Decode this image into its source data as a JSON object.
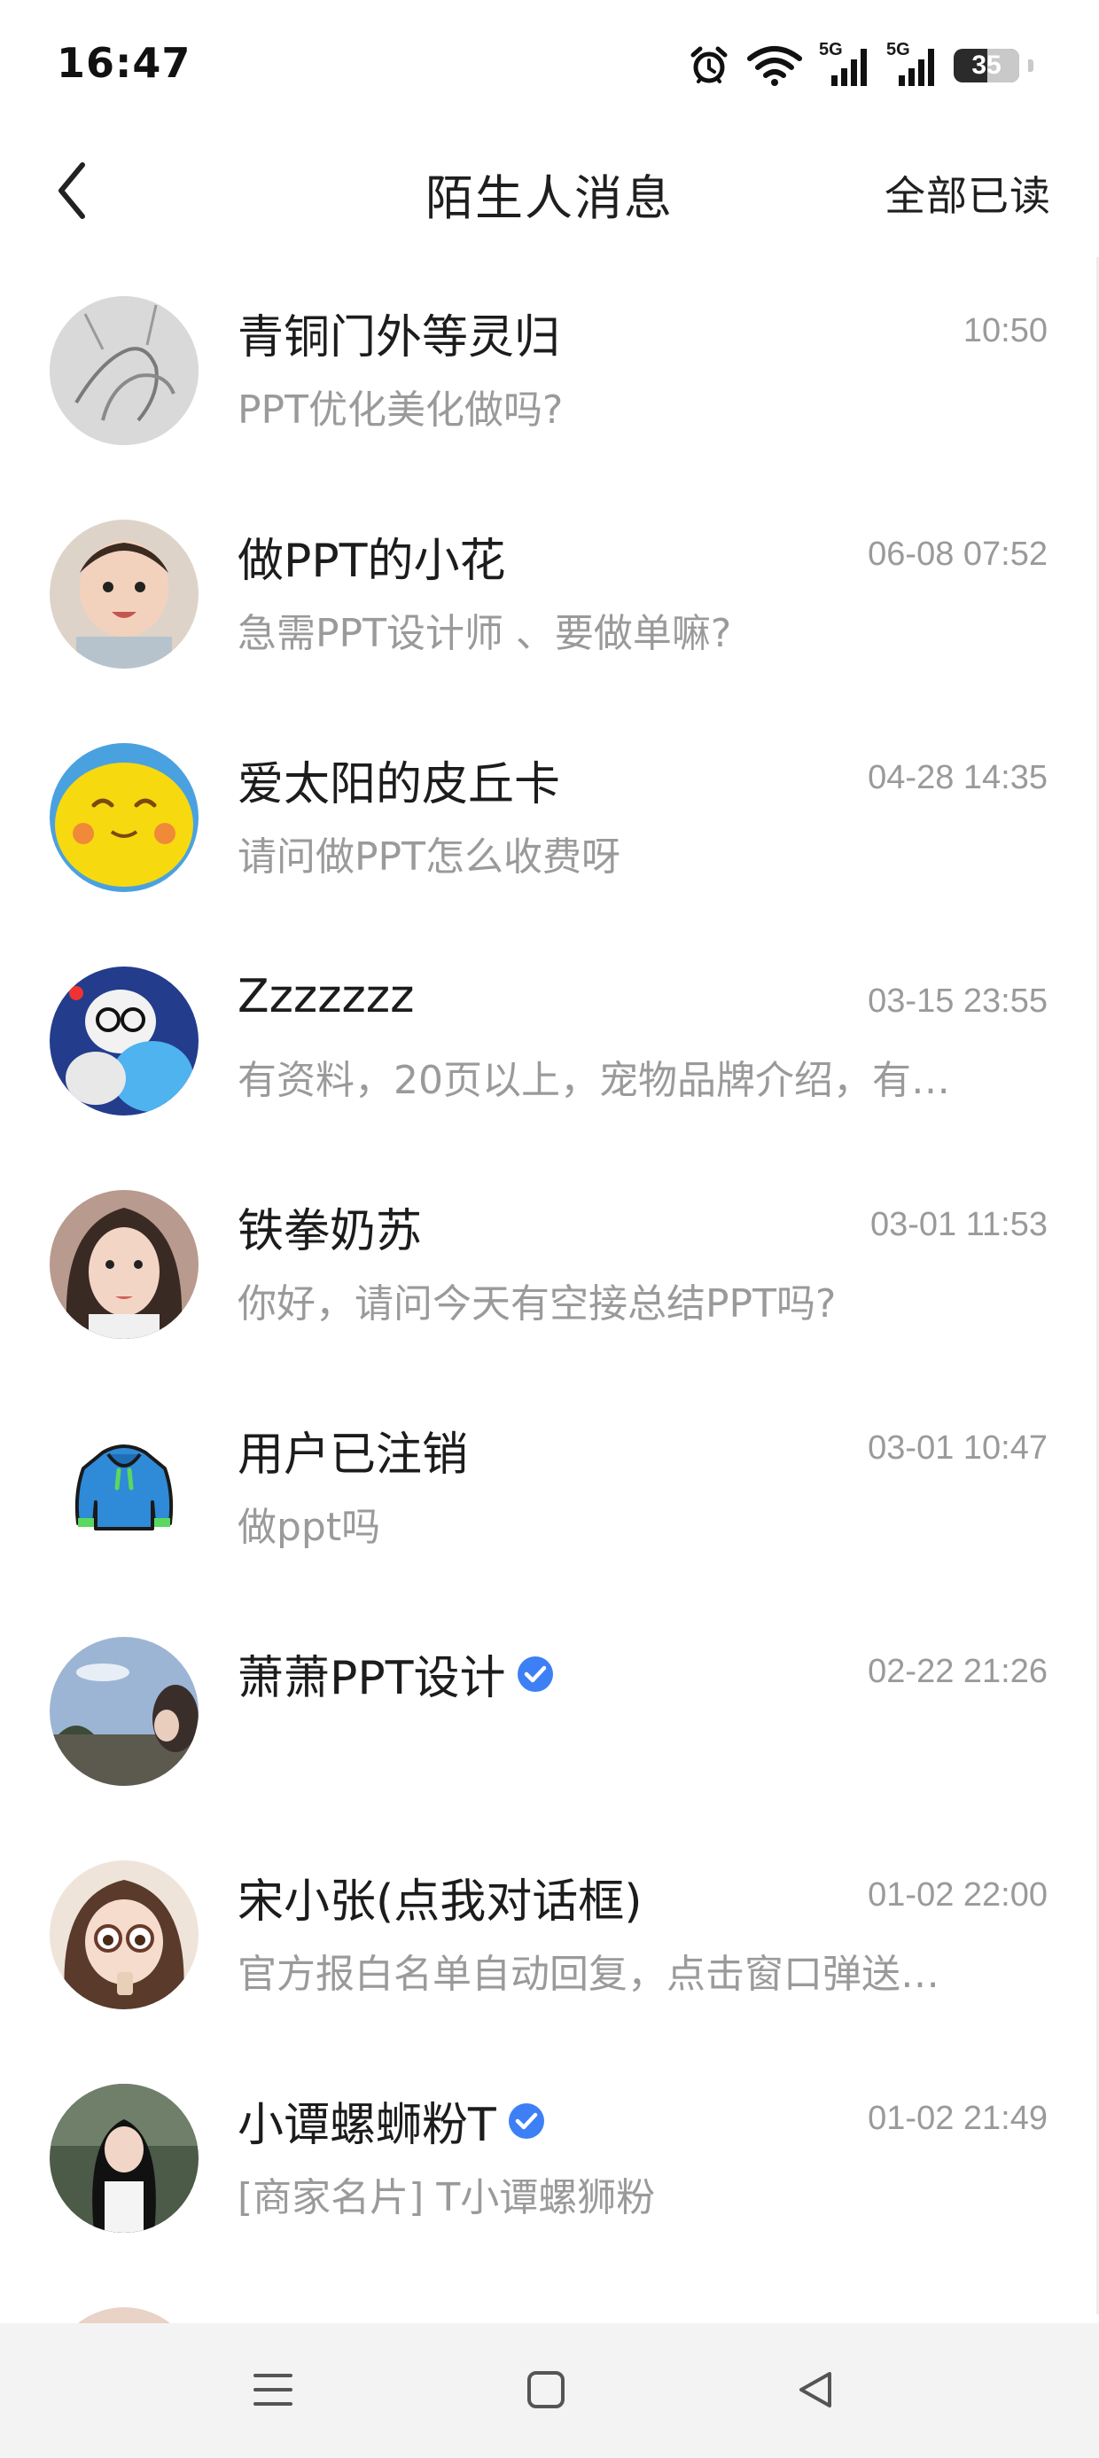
{
  "status_bar": {
    "time": "16:47",
    "network_1": "5G",
    "network_2": "5G",
    "battery": "35",
    "icons": [
      "alarm-icon",
      "wifi-icon",
      "signal-5g-icon",
      "signal-5g-icon",
      "battery-icon"
    ]
  },
  "header": {
    "title": "陌生人消息",
    "mark_all_read": "全部已读",
    "back_icon": "chevron-left-icon"
  },
  "conversations": [
    {
      "name": "青铜门外等灵归",
      "time": "10:50",
      "preview": "PPT优化美化做吗?",
      "verified": false,
      "avatar_color": "#d9d9d9"
    },
    {
      "name": "做PPT的小花",
      "time": "06-08 07:52",
      "preview": "急需PPT设计师 、要做单嘛?",
      "verified": false,
      "avatar_color": "#e8c9b5"
    },
    {
      "name": "爱太阳的皮丘卡",
      "time": "04-28 14:35",
      "preview": "请问做PPT怎么收费呀",
      "verified": false,
      "avatar_color": "#f5d511"
    },
    {
      "name": "Zzzzzzz",
      "time": "03-15 23:55",
      "preview": "有资料，20页以上，宠物品牌介绍，有…",
      "verified": false,
      "avatar_color": "#2c4da8"
    },
    {
      "name": "铁拳奶苏",
      "time": "03-01 11:53",
      "preview": "你好，请问今天有空接总结PPT吗?",
      "verified": false,
      "avatar_color": "#c9a79a"
    },
    {
      "name": "用户已注销",
      "time": "03-01 10:47",
      "preview": "做ppt吗",
      "verified": false,
      "avatar_color": "#ffffff"
    },
    {
      "name": "萧萧PPT设计",
      "time": "02-22 21:26",
      "preview": "",
      "verified": true,
      "avatar_color": "#8aa6c9"
    },
    {
      "name": "宋小张(点我对话框)",
      "time": "01-02 22:00",
      "preview": "官方报白名单自动回复，点击窗口弹送…",
      "verified": false,
      "avatar_color": "#d7b49c"
    },
    {
      "name": "小谭螺蛳粉T",
      "time": "01-02 21:49",
      "preview": "[商家名片] T小谭螺狮粉",
      "verified": true,
      "avatar_color": "#4a5a4a"
    }
  ],
  "nav_bar": {
    "icons": [
      "menu-icon",
      "home-square-icon",
      "back-triangle-icon"
    ]
  },
  "colors": {
    "text_primary": "#1c1c1c",
    "text_secondary": "#9a9a9a",
    "verified_blue": "#3d7ff5",
    "nav_bg": "#f3f3f3"
  }
}
